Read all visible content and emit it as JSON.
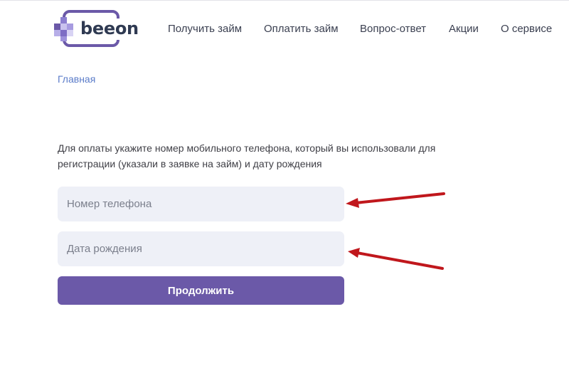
{
  "header": {
    "logo_text": "beeon",
    "nav": [
      {
        "label": "Получить займ"
      },
      {
        "label": "Оплатить займ"
      },
      {
        "label": "Вопрос-ответ"
      },
      {
        "label": "Акции"
      },
      {
        "label": "О сервисе"
      }
    ]
  },
  "breadcrumb": {
    "home": "Главная"
  },
  "form": {
    "instruction": "Для оплаты укажите номер мобильного телефона, который вы использовали для регистрации (указали в заявке на займ) и дату рождения",
    "phone_placeholder": "Номер телефона",
    "phone_value": "",
    "birthdate_placeholder": "Дата рождения",
    "birthdate_value": "",
    "submit_label": "Продолжить"
  },
  "colors": {
    "brand": "#6b59a8",
    "field_bg": "#eef0f7",
    "link": "#5b7cc9",
    "annotation_arrow": "#c0171c"
  },
  "icons": [
    "beeon-logo-icon",
    "red-arrow-annotation"
  ]
}
